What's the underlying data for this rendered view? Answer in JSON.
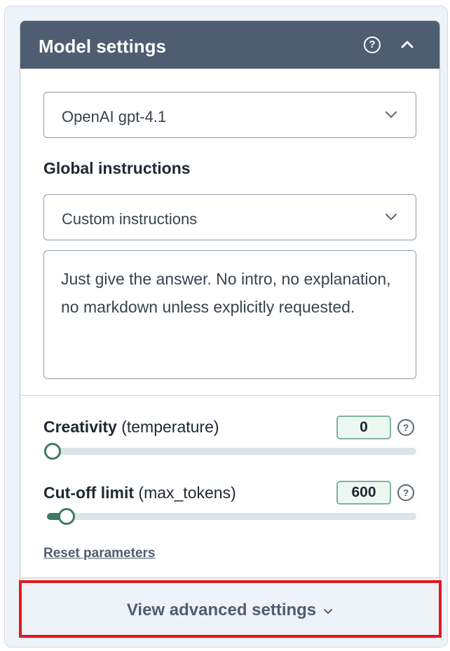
{
  "panel": {
    "title": "Model settings",
    "help_glyph": "?"
  },
  "model_select": {
    "value": "OpenAI gpt-4.1"
  },
  "global_instructions": {
    "label": "Global instructions",
    "select_value": "Custom instructions",
    "text": "Just give the answer. No intro, no explanation, no markdown unless explicitly requested."
  },
  "params": {
    "creativity": {
      "label_bold": "Creativity",
      "label_rest": " (temperature)",
      "value": "0",
      "level": 0,
      "help_glyph": "?"
    },
    "cutoff": {
      "label_bold": "Cut-off limit",
      "label_rest": " (max_tokens)",
      "value": "600",
      "level": 0.04,
      "help_glyph": "?"
    }
  },
  "reset_link": "Reset parameters",
  "advanced": {
    "label": "View advanced settings"
  },
  "colors": {
    "header_bg": "#4e5d70",
    "accent": "#3c7a66",
    "highlight": "#e0191d"
  },
  "icons": [
    "help-circle-icon",
    "chevron-up-icon",
    "chevron-down-icon"
  ]
}
